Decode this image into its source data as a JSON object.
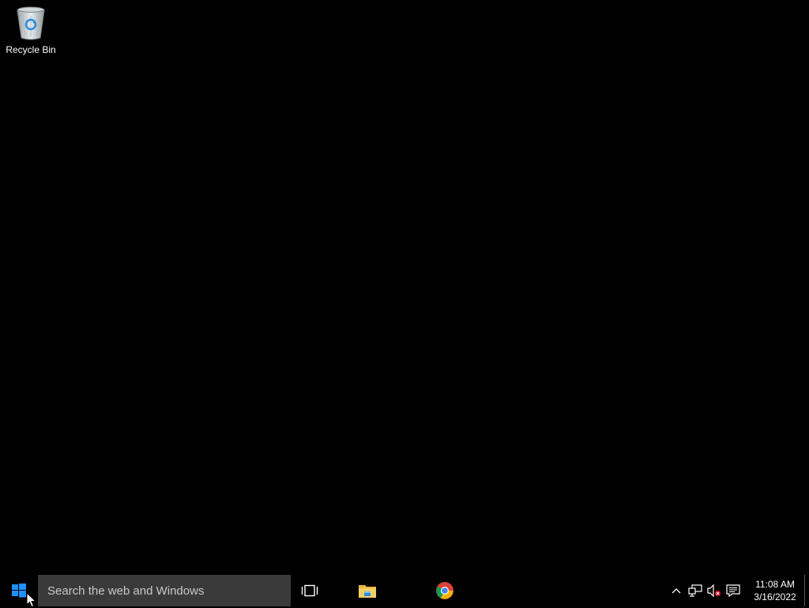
{
  "desktop": {
    "background_color": "#000000",
    "icons": [
      {
        "label": "Recycle Bin",
        "icon": "recycle-bin-icon"
      }
    ]
  },
  "taskbar": {
    "background_color": "#000000",
    "start_icon": "windows-logo-icon",
    "search": {
      "placeholder": "Search the web and Windows"
    },
    "task_view_icon": "task-view-icon",
    "pinned_apps": [
      {
        "name": "File Explorer",
        "icon": "file-explorer-icon"
      },
      {
        "name": "Google Chrome",
        "icon": "chrome-icon"
      }
    ],
    "tray": {
      "icons": [
        "chevron-up-icon",
        "network-icon",
        "volume-muted-icon",
        "action-center-icon"
      ]
    },
    "clock": {
      "time": "11:08 AM",
      "date": "3/16/2022"
    }
  },
  "colors": {
    "accent": "#1e90ff",
    "search_bg": "#3a3a3a"
  }
}
